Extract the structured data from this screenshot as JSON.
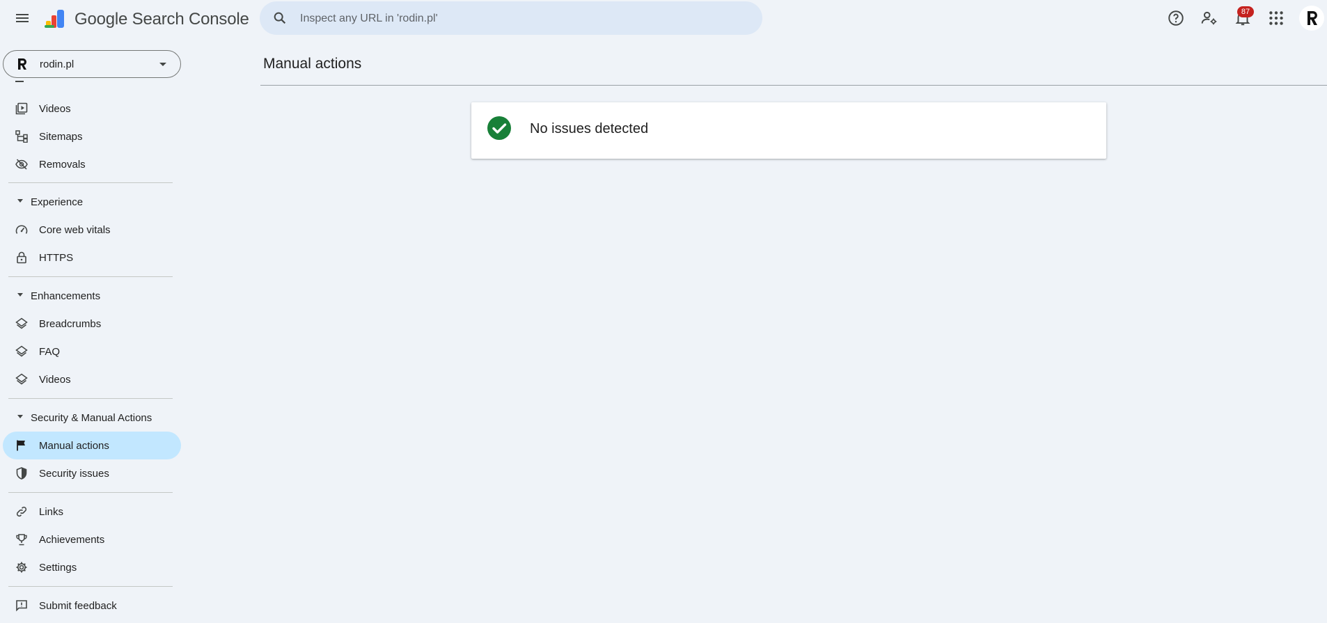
{
  "header": {
    "brand": "Google Search Console",
    "search_placeholder": "Inspect any URL in 'rodin.pl'",
    "notification_count": "87",
    "icons": [
      "menu-icon",
      "search-console-logo",
      "search-icon",
      "help-icon",
      "manage-users-icon",
      "notifications-icon",
      "apps-icon",
      "avatar"
    ]
  },
  "property": {
    "name": "rodin.pl"
  },
  "sidebar": {
    "items_top": [
      {
        "label": "Videos",
        "icon": "video-library-icon"
      },
      {
        "label": "Sitemaps",
        "icon": "sitemap-icon"
      },
      {
        "label": "Removals",
        "icon": "eye-off-icon"
      }
    ],
    "experience": {
      "title": "Experience",
      "items": [
        {
          "label": "Core web vitals",
          "icon": "speedometer-icon"
        },
        {
          "label": "HTTPS",
          "icon": "lock-icon"
        }
      ]
    },
    "enhancements": {
      "title": "Enhancements",
      "items": [
        {
          "label": "Breadcrumbs",
          "icon": "layers-icon"
        },
        {
          "label": "FAQ",
          "icon": "layers-icon"
        },
        {
          "label": "Videos",
          "icon": "layers-icon"
        }
      ]
    },
    "security": {
      "title": "Security & Manual Actions",
      "items": [
        {
          "label": "Manual actions",
          "icon": "flag-icon",
          "active": true
        },
        {
          "label": "Security issues",
          "icon": "shield-icon"
        }
      ]
    },
    "items_bottom": [
      {
        "label": "Links",
        "icon": "link-icon"
      },
      {
        "label": "Achievements",
        "icon": "trophy-icon"
      },
      {
        "label": "Settings",
        "icon": "gear-icon"
      }
    ],
    "feedback": {
      "label": "Submit feedback",
      "icon": "feedback-icon"
    }
  },
  "main": {
    "title": "Manual actions",
    "status_message": "No issues detected"
  },
  "colors": {
    "background": "#eff3f8",
    "search_bg": "#dde8f6",
    "active_nav": "#c2e7ff",
    "success": "#188038",
    "badge": "#c5221f"
  }
}
